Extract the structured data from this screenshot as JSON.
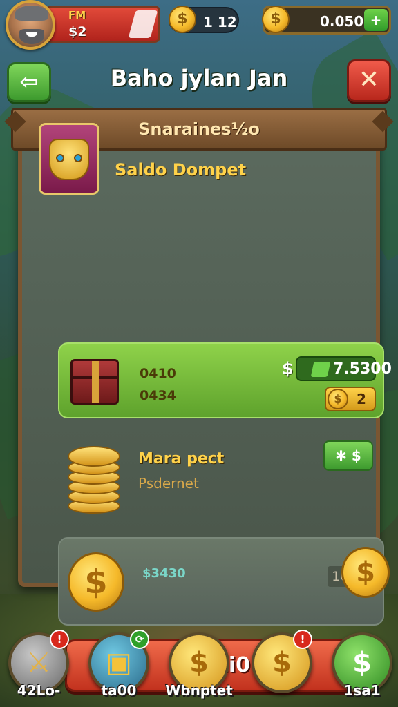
{
  "player": {
    "health_label": "FM",
    "health_value": "$2"
  },
  "currency": {
    "coins": "1 12",
    "gems": "0.050",
    "add_symbol": "+"
  },
  "header": {
    "title": "Baho jylan Jan",
    "back_symbol": "⇦",
    "close_symbol": "✕"
  },
  "panel": {
    "banner": "Snaraines½o",
    "section_title": "Saldo Dompet",
    "row1": {
      "line1": "0410",
      "line2": "0434",
      "price_symbol": "$",
      "price": "7.5300",
      "coin_count": "2"
    },
    "row2": {
      "line1": "Mara pect",
      "line2": "Psdernet",
      "button": "✱ $"
    },
    "row3": {
      "amount": "$3430",
      "value": "1000)"
    },
    "main_button": "Aldi0"
  },
  "bottom_nav": [
    {
      "label": "42Lo-",
      "badge": "!",
      "icon": "sword-icon"
    },
    {
      "label": "ta00",
      "badge": "⟳",
      "icon": "chest-icon"
    },
    {
      "label": "Wbnptet",
      "badge": "",
      "icon": "coin-icon"
    },
    {
      "label": "",
      "badge": "!",
      "icon": "coin-icon"
    },
    {
      "label": "1sa1",
      "badge": "",
      "icon": "dollar-icon"
    }
  ],
  "colors": {
    "accent_green": "#5ea22c",
    "accent_red": "#c2321e",
    "gold": "#f5b92a",
    "wood": "#7a5632"
  }
}
